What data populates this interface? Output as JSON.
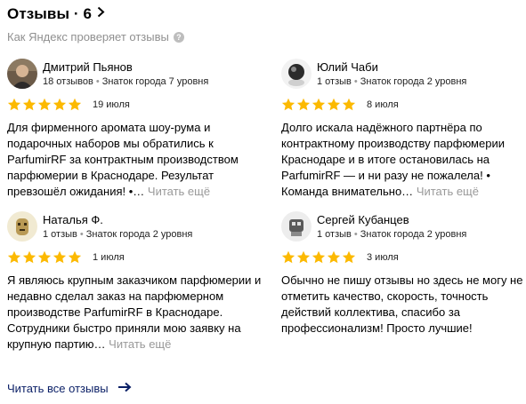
{
  "header": {
    "title": "Отзывы · 6",
    "subtitle": "Как Яндекс проверяет отзывы",
    "help_glyph": "?"
  },
  "reviews": [
    {
      "name": "Дмитрий Пьянов",
      "reviews_count": "18 отзывов",
      "level": "Знаток города 7 уровня",
      "rating": 5,
      "date": "19 июля",
      "text": "Для фирменного аромата шоу-рума и подарочных наборов мы обратились к ParfumirRF за контрактным производством парфюмерии в Краснодаре. Результат превзошёл ожидания! •…",
      "more": "Читать ещё"
    },
    {
      "name": "Юлий Чаби",
      "reviews_count": "1 отзыв",
      "level": "Знаток города 2 уровня",
      "rating": 5,
      "date": "8 июля",
      "text": "Долго искала надёжного партнёра по контрактному производству парфюмерии Краснодаре и в итоге остановилась на ParfumirRF — и ни разу не пожалела! • Команда внимательно…",
      "more": "Читать ещё"
    },
    {
      "name": "Наталья Ф.",
      "reviews_count": "1 отзыв",
      "level": "Знаток города 2 уровня",
      "rating": 5,
      "date": "1 июля",
      "text": "Я являюсь крупным заказчиком парфюмерии и недавно сделал заказ на парфюмерном производстве ParfumirRF в Краснодаре. Сотрудники быстро приняли мою заявку на крупную партию…",
      "more": "Читать ещё"
    },
    {
      "name": "Сергей Кубанцев",
      "reviews_count": "1 отзыв",
      "level": "Знаток города 2 уровня",
      "rating": 5,
      "date": "3 июля",
      "text": "Обычно не пишу отзывы но здесь не могу не отметить качество, скорость, точность действий коллектива, спасибо за профессионализм! Просто лучшие!",
      "more": ""
    }
  ],
  "footer": {
    "read_all": "Читать все отзывы"
  },
  "colors": {
    "star": "#fcb900",
    "link": "#0a1f66",
    "muted": "#909090"
  }
}
